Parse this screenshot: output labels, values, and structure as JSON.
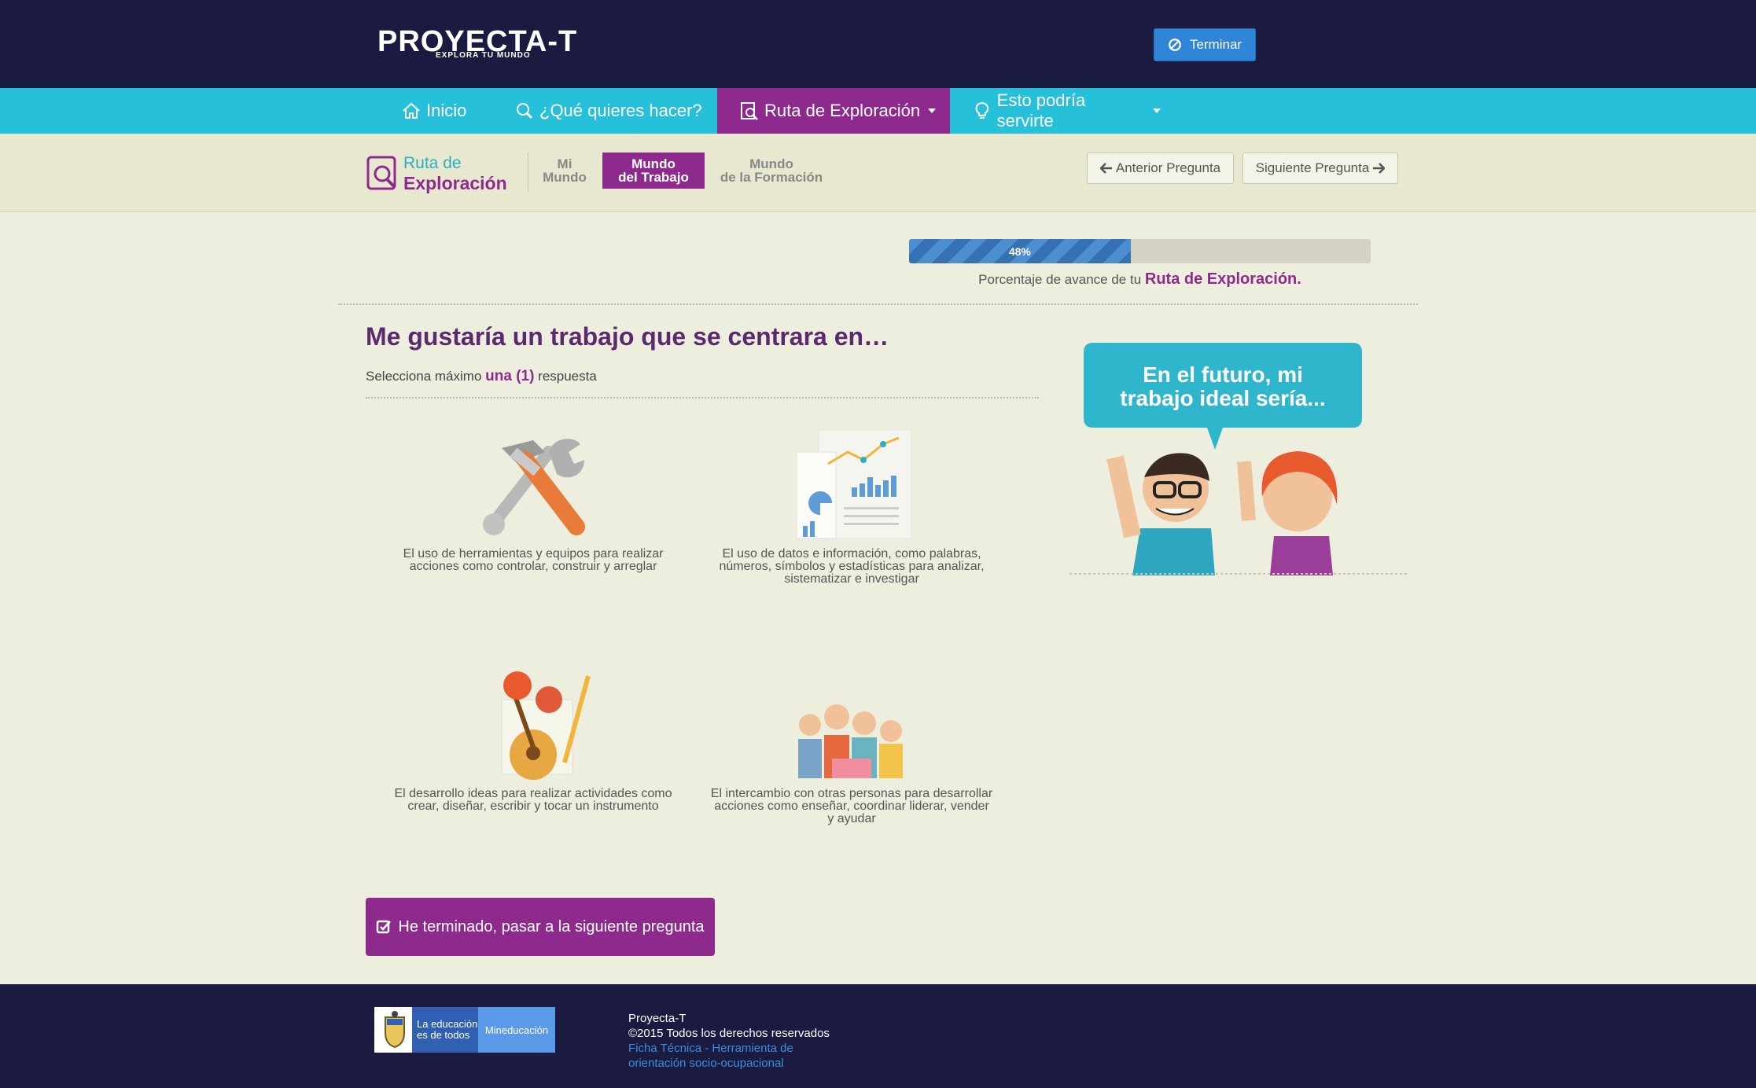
{
  "header": {
    "logo_text": "PROYECTA-T",
    "logo_tagline": "EXPLORA TU MUNDO",
    "finish_button": "Terminar"
  },
  "nav": {
    "items": [
      {
        "label": "Inicio",
        "icon": "home-icon"
      },
      {
        "label": "¿Qué quieres hacer?",
        "icon": "search-icon"
      },
      {
        "label": "Ruta de Exploración",
        "icon": "magnifier-doc-icon",
        "active": true
      },
      {
        "label": "Esto podría servirte",
        "icon": "lightbulb-icon"
      }
    ]
  },
  "route": {
    "title_line1": "Ruta de",
    "title_line2": "Exploración",
    "stages": [
      {
        "line1": "Mi",
        "line2": "Mundo"
      },
      {
        "line1": "Mundo",
        "line2": "del Trabajo",
        "active": true
      },
      {
        "line1": "Mundo",
        "line2": "de la Formación"
      }
    ],
    "prev_button": "Anterior Pregunta",
    "next_button": "Siguiente Pregunta"
  },
  "progress": {
    "value": 0.48,
    "label": "48%",
    "caption_prefix": "Porcentaje de avance de tu",
    "caption_strong": "Ruta de Exploración."
  },
  "question": {
    "title": "Me gustaría un trabajo que se centrara en…",
    "instruction_prefix": "Selecciona máximo",
    "instruction_strong": "una (1)",
    "instruction_suffix": "respuesta",
    "options": [
      {
        "text": "El uso de herramientas y equipos para realizar acciones como controlar, construir y arreglar",
        "icon": "tools-icon"
      },
      {
        "text": "El uso de datos e información, como palabras, números, símbolos y estadísticas para analizar, sistematizar e investigar",
        "icon": "charts-icon"
      },
      {
        "text": "El desarrollo ideas para realizar actividades como crear, diseñar, escribir y tocar un instrumento",
        "icon": "art-icon"
      },
      {
        "text": "El intercambio con otras personas para desarrollar acciones como enseñar, coordinar liderar, vender y ayudar",
        "icon": "people-icon"
      }
    ],
    "submit_button": "He terminado, pasar a la siguiente pregunta"
  },
  "bubble": {
    "line1": "En el futuro, mi",
    "line2": "trabajo ideal sería..."
  },
  "footer": {
    "gov_line1": "La educación",
    "gov_line2": "es de todos",
    "gov_ministry": "Mineducación",
    "brand": "Proyecta-T",
    "copyright": "©2015 Todos los derechos reservados",
    "link_line1": "Ficha Técnica - Herramienta de",
    "link_line2": "orientación socio-ocupacional"
  },
  "colors": {
    "header_bg": "#1b1a40",
    "nav_bg": "#27c0da",
    "accent_purple": "#8e2a8e",
    "button_blue": "#2f86d8"
  }
}
